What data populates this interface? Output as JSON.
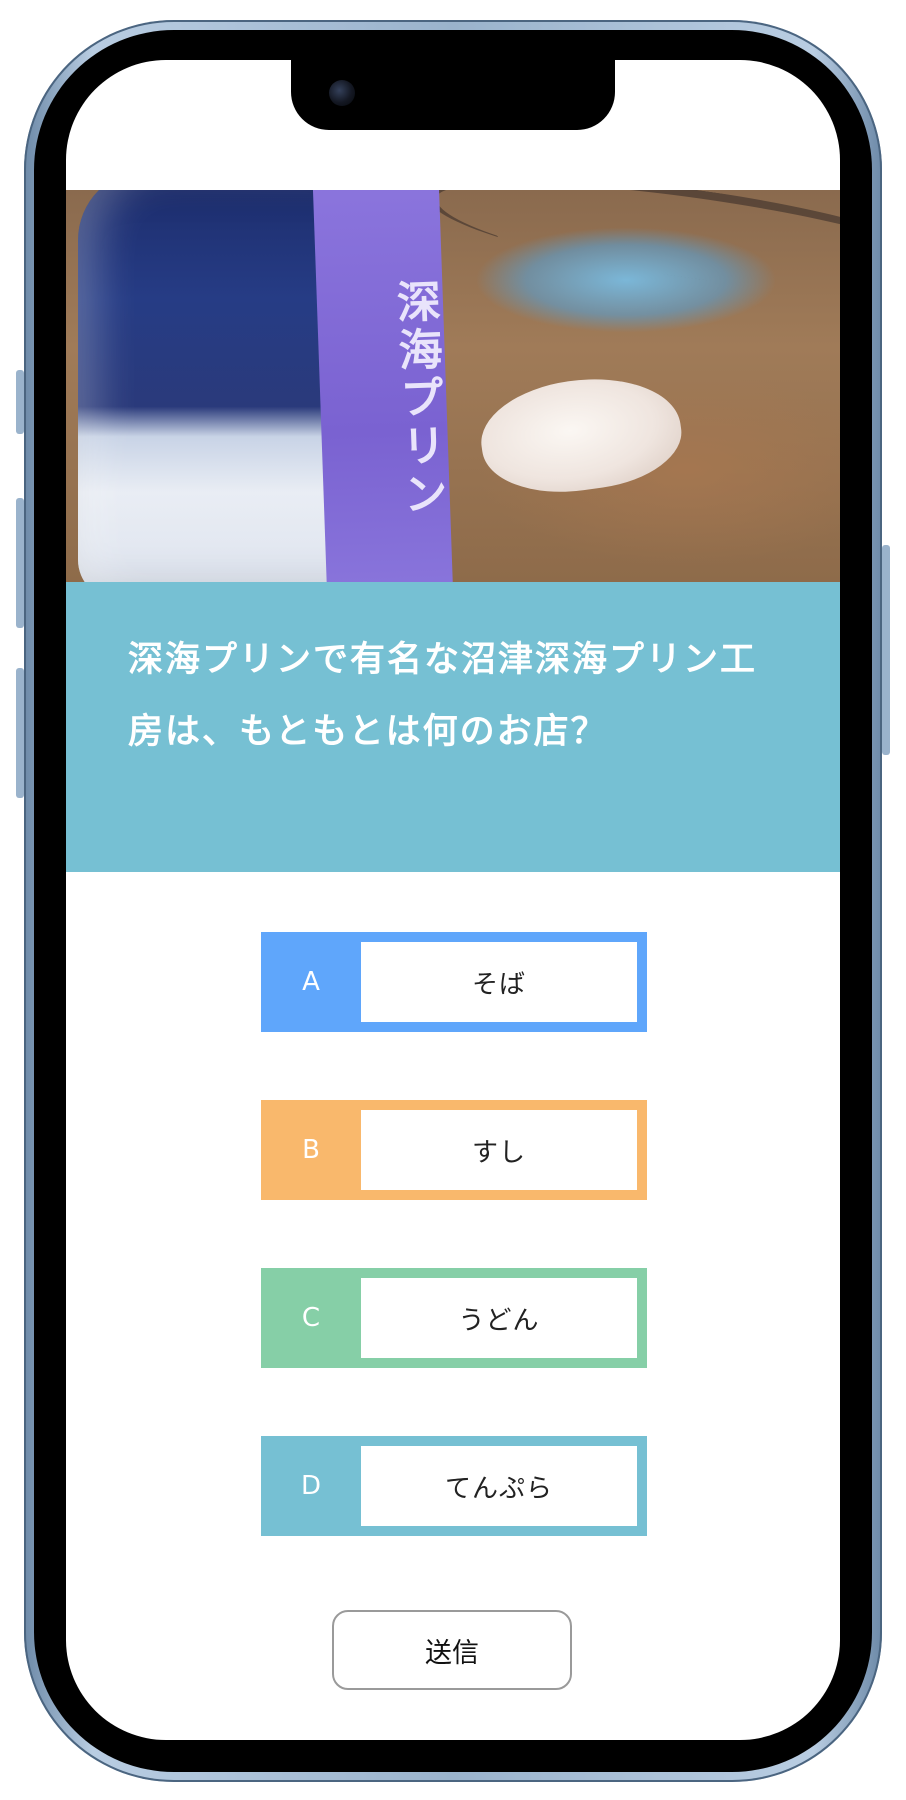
{
  "quiz": {
    "image_ribbon_text": "深海プリン",
    "question": "深海プリンで有名な沼津深海プリン工房は、もともとは何のお店？",
    "options": [
      {
        "letter": "A",
        "label": "そば"
      },
      {
        "letter": "B",
        "label": "すし"
      },
      {
        "letter": "C",
        "label": "うどん"
      },
      {
        "letter": "D",
        "label": "てんぷら"
      }
    ],
    "submit_label": "送信"
  },
  "colors": {
    "question_panel": "#76c0d3",
    "option_a": "#5fa6fb",
    "option_b": "#f9b86c",
    "option_c": "#86cfa7",
    "option_d": "#76c0d3"
  }
}
